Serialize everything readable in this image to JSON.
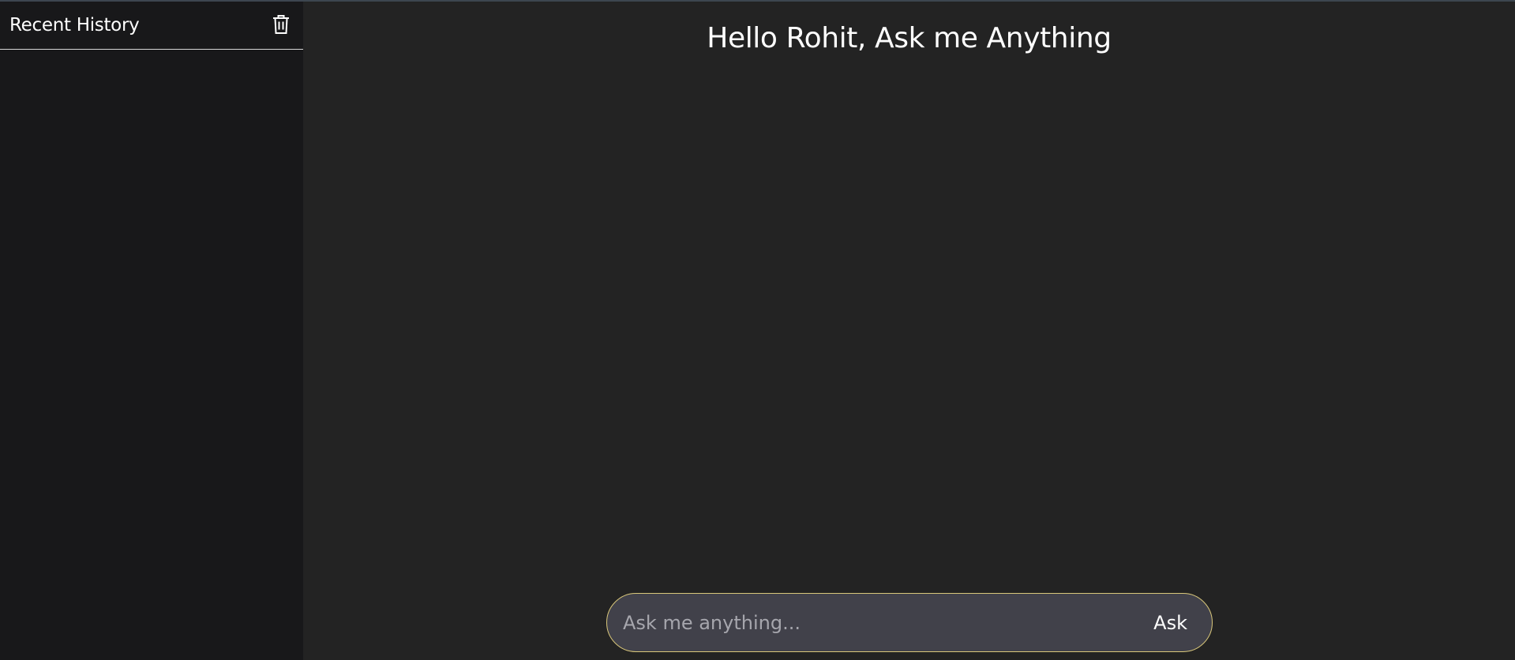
{
  "sidebar": {
    "title": "Recent History",
    "clear_icon": "trash-icon",
    "items": []
  },
  "main": {
    "greeting": "Hello Rohit, Ask me Anything"
  },
  "ask_bar": {
    "placeholder": "Ask me anything...",
    "value": "",
    "button_label": "Ask"
  },
  "colors": {
    "sidebar_bg": "#18181a",
    "main_bg": "#232323",
    "input_bg": "#41414a",
    "input_border": "#d9c77a",
    "text": "#ffffff"
  }
}
